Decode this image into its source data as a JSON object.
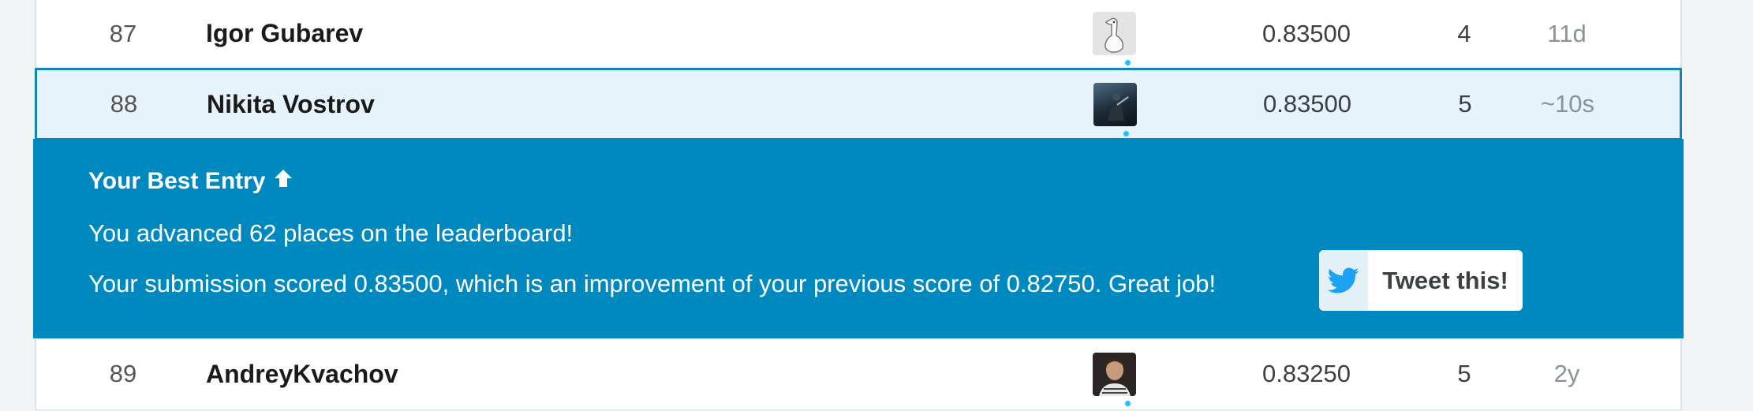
{
  "colors": {
    "banner_bg": "#0089bf",
    "highlight_row_bg": "#e7f3fa",
    "highlight_row_border": "#1385b6",
    "online_dot": "#20beff",
    "twitter_blue": "#1da1f2"
  },
  "leaderboard": {
    "rows": [
      {
        "rank": "87",
        "team": "Igor Gubarev",
        "avatar_icon": "goose-avatar",
        "score": "0.83500",
        "entries": "4",
        "last": "11d"
      },
      {
        "rank": "88",
        "team": "Nikita Vostrov",
        "avatar_icon": "robot-avatar",
        "score": "0.83500",
        "entries": "5",
        "last": "~10s"
      },
      {
        "rank": "89",
        "team": "AndreyKvachov",
        "avatar_icon": "person-avatar",
        "score": "0.83250",
        "entries": "5",
        "last": "2y"
      }
    ]
  },
  "banner": {
    "title": "Your Best Entry",
    "title_icon": "arrow-up-icon",
    "line1": "You advanced 62 places on the leaderboard!",
    "line2": "Your submission scored 0.83500, which is an improvement of your previous score of 0.82750. Great job!",
    "tweet_label": "Tweet this!",
    "tweet_icon": "twitter-bird-icon"
  }
}
